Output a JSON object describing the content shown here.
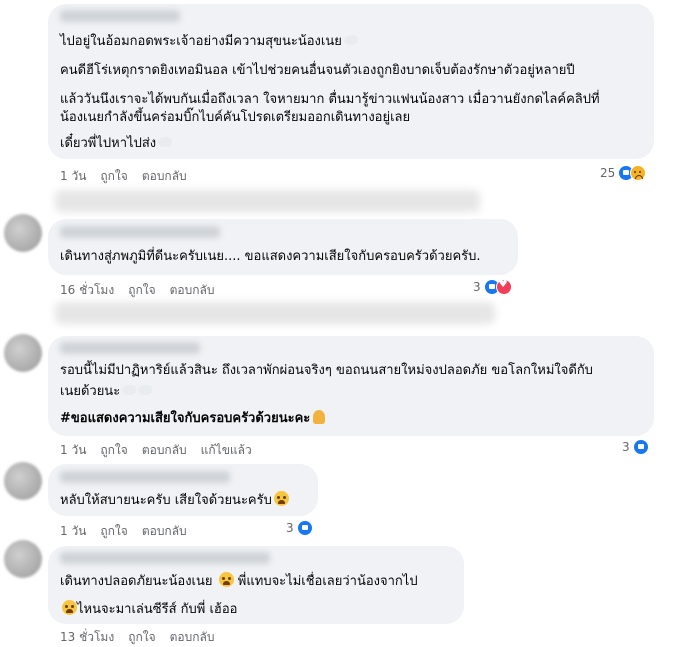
{
  "comments": [
    {
      "lines": [
        "ไปอยู่ในอ้อมกอดพระเจ้าอย่างมีความสุขนะน้องเนย",
        "คนดีฮีโร่เหตุกราดยิงเทอมินอล เข้าไปช่วยคนอื่นจนตัวเองถูกยิงบาดเจ็บต้องรักษาตัวอยู่หลายปี",
        "แล้ววันนึงเราจะได้พบกันเมื่อถึงเวลา ใจหายมาก ตื่นมารู้ข่าวแฟนน้องสาว เมื่อวานยังกดไลค์คลิปที่",
        "น้องเนยกำลังขึ้นคร่อมบิ๊กไบค์คันโปรดเตรียมออกเดินทางอยู่เลย",
        "เดี๋ยวพี่ไปหาไปส่ง"
      ],
      "time": "1 วัน",
      "like": "ถูกใจ",
      "reply": "ตอบกลับ",
      "reaction_count": "25",
      "reactions": [
        "like-icon",
        "sad-icon"
      ]
    },
    {
      "lines": [
        "เดินทางสู่ภพภูมิที่ดีนะครับเนย.... ขอแสดงความเสียใจกับครอบครัวด้วยครับ."
      ],
      "time": "16 ชั่วโมง",
      "like": "ถูกใจ",
      "reply": "ตอบกลับ",
      "reaction_count": "3",
      "reactions": [
        "like-icon",
        "love-icon"
      ]
    },
    {
      "lines": [
        "รอบนี้ไม่มีปาฏิหาริย์แล้วสินะ ถึงเวลาพักผ่อนจริงๆ ขอถนนสายใหม่จงปลอดภัย ขอโลกใหม่ใจดีกับ",
        "เนยด้วยนะ"
      ],
      "hashtag": "#ขอแสดงความเสียใจกับครอบครัวด้วยนะคะ",
      "time": "1 วัน",
      "like": "ถูกใจ",
      "reply": "ตอบกลับ",
      "edited": "แก้ไขแล้ว",
      "reaction_count": "3",
      "reactions": [
        "like-icon"
      ]
    },
    {
      "lines": [
        "หลับให้สบายนะครับ เสียใจด้วยนะครับ"
      ],
      "time": "1 วัน",
      "like": "ถูกใจ",
      "reply": "ตอบกลับ",
      "reaction_count": "3",
      "reactions": [
        "like-icon"
      ]
    },
    {
      "lines": [
        "เดินทางปลอดภัยนะน้องเนย",
        "พี่แทบจะไม่เชื่อเลยว่าน้องจากไป",
        "ไหนจะมาเล่นซีรีส์ กับพี่ เฮ้ออ"
      ],
      "time": "13 ชั่วโมง",
      "like": "ถูกใจ",
      "reply": "ตอบกลับ"
    }
  ],
  "colors": {
    "bubble": "#f0f2f5",
    "meta_text": "#65676b",
    "like_blue": "#1877f2",
    "love_red": "#f33e58",
    "sad_yellow": "#f7b125"
  }
}
